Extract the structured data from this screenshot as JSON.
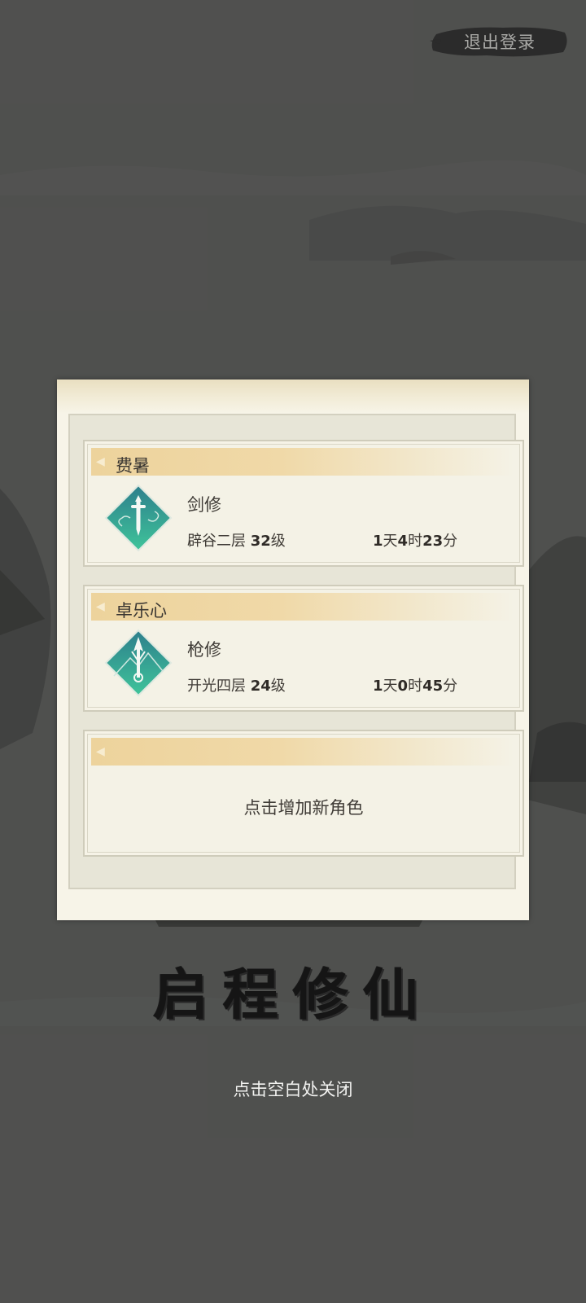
{
  "header": {
    "logout_label": "退出登录"
  },
  "modal": {
    "characters": [
      {
        "name": "费暑",
        "class": "剑修",
        "realm": "辟谷二层",
        "level_num": "32",
        "level_unit": "级",
        "duration": {
          "d": "1",
          "h": "4",
          "m": "23"
        },
        "icon": "sword-icon"
      },
      {
        "name": "卓乐心",
        "class": "枪修",
        "realm": "开光四层",
        "level_num": "24",
        "level_unit": "级",
        "duration": {
          "d": "1",
          "h": "0",
          "m": "45"
        },
        "icon": "spear-icon"
      }
    ],
    "add_character_label": "点击增加新角色"
  },
  "units": {
    "day": "天",
    "hour": "时",
    "minute": "分"
  },
  "start_title": "启程修仙",
  "close_hint": "点击空白处关闭",
  "colors": {
    "banner": "#edd39c",
    "icon_teal": "#2a8a8f",
    "modal_bg": "#f7f4e8"
  }
}
